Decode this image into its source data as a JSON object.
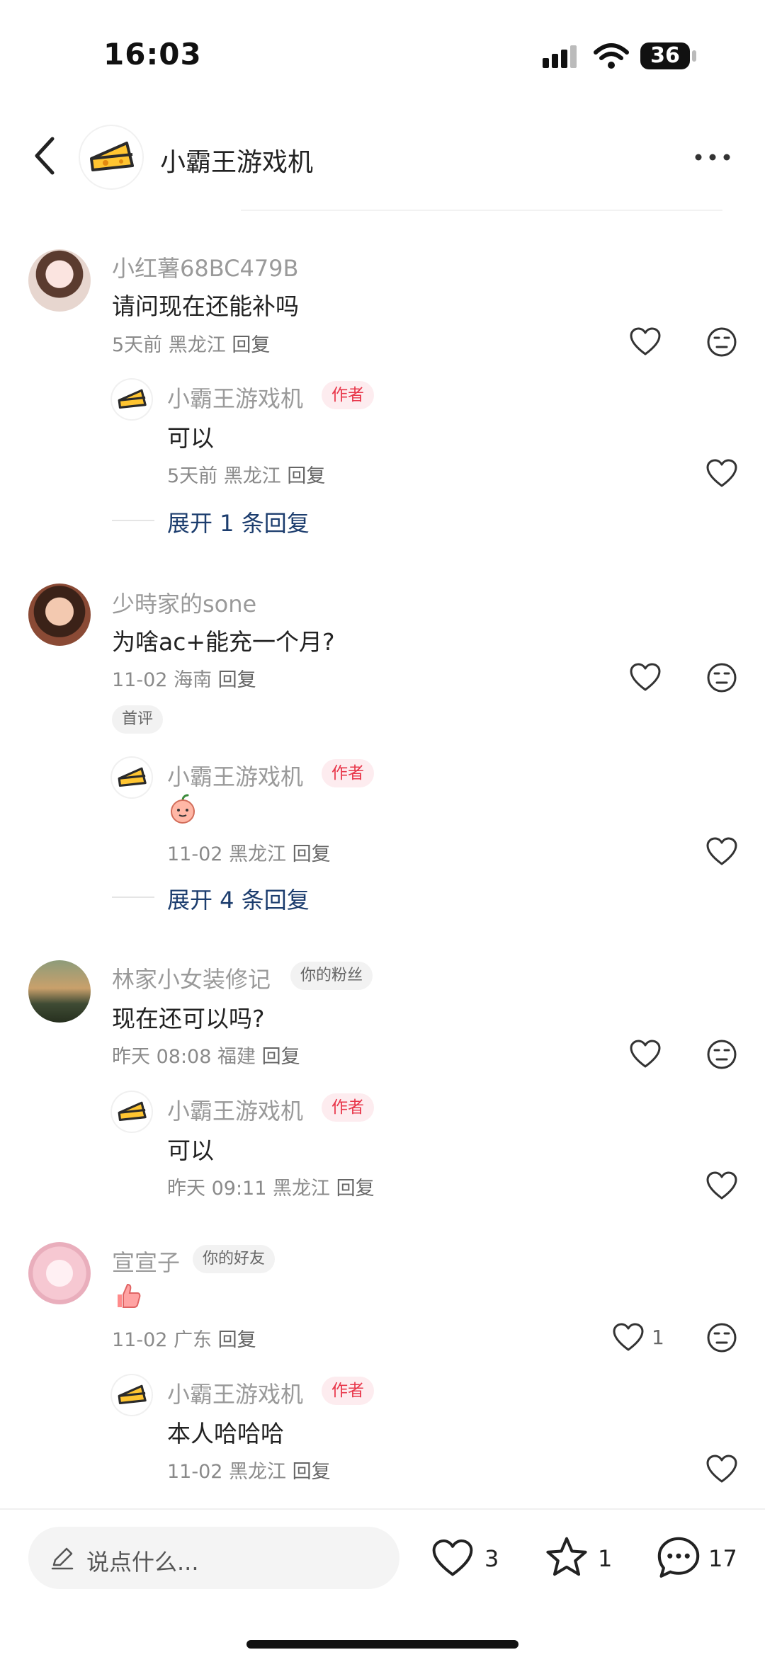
{
  "status_bar": {
    "time": "16:03",
    "battery": "36"
  },
  "header": {
    "title": "小霸王游戏机",
    "avatar_icon": "cheese-icon"
  },
  "colors": {
    "author_tag": "#e8364a",
    "expand_link": "#1c3d6e"
  },
  "comments": [
    {
      "name": "小红薯68BC479B",
      "content": "请问现在还能补吗",
      "time": "5天前",
      "location": "黑龙江",
      "reply": "回复",
      "reply_item": {
        "name": "小霸王游戏机",
        "tag": "作者",
        "content": "可以",
        "time": "5天前",
        "location": "黑龙江",
        "reply": "回复"
      },
      "expand": "展开 1 条回复"
    },
    {
      "name": "少時家的sone",
      "content": "为啥ac+能充一个月?",
      "time": "11-02",
      "location": "海南",
      "reply": "回复",
      "badge": "首评",
      "reply_item": {
        "name": "小霸王游戏机",
        "tag": "作者",
        "content_icon": "peach-emoji",
        "time": "11-02",
        "location": "黑龙江",
        "reply": "回复"
      },
      "expand": "展开 4 条回复"
    },
    {
      "name": "林家小女装修记",
      "tag": "你的粉丝",
      "content": "现在还可以吗?",
      "time": "昨天 08:08",
      "location": "福建",
      "reply": "回复",
      "reply_item": {
        "name": "小霸王游戏机",
        "tag": "作者",
        "content": "可以",
        "time": "昨天 09:11",
        "location": "黑龙江",
        "reply": "回复"
      }
    },
    {
      "name": "宣宣子",
      "tag": "你的好友",
      "content_icon": "thumbs-up-emoji",
      "time": "11-02",
      "location": "广东",
      "reply": "回复",
      "likes": "1",
      "reply_item": {
        "name": "小霸王游戏机",
        "tag": "作者",
        "content": "本人哈哈哈",
        "time": "11-02",
        "location": "黑龙江",
        "reply": "回复"
      }
    }
  ],
  "bottom_bar": {
    "placeholder": "说点什么...",
    "likes": "3",
    "favorites": "1",
    "comments": "17"
  }
}
